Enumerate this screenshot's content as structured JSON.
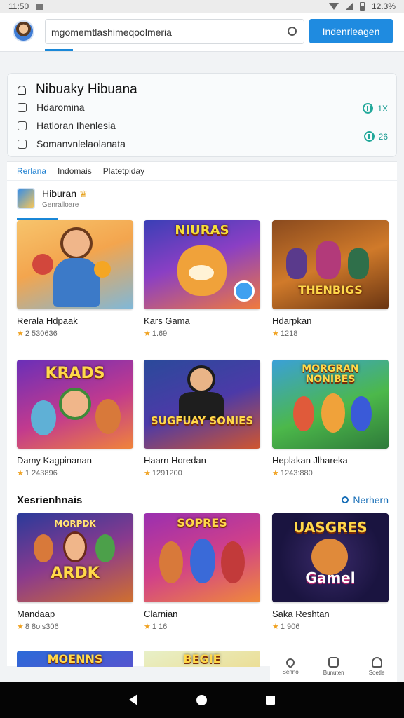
{
  "status_bar": {
    "time": "11:50",
    "battery": "12.3%"
  },
  "top_bar": {
    "search_value": "mgomemtlashimeqoolmeria",
    "button_label": "Indenrleagen"
  },
  "info_card": {
    "title": "Nibuaky Hibuana",
    "lines": [
      "Hdaromina",
      "Hatloran Ihenlesia",
      "Somanvnlelaolanata"
    ],
    "stats": [
      "1X",
      "26"
    ]
  },
  "tabs": [
    "Rerlana",
    "Indomais",
    "Platetpiday"
  ],
  "section": {
    "title": "Hiburan",
    "subtitle": "Genralloare"
  },
  "games_top": [
    {
      "name": "Rerala Hdpaak",
      "meta": "2 530636",
      "art": ""
    },
    {
      "name": "Kars Gama",
      "meta": "1.69",
      "art": "NIURAS"
    },
    {
      "name": "Hdarpkan",
      "meta": "1218",
      "art": "THENBIGS"
    },
    {
      "name": "Damy Kagpinanan",
      "meta": "1 243896",
      "art": "KRADS"
    },
    {
      "name": "Haarn Horedan",
      "meta": "1291200",
      "art": "SUGFUAY SONIES"
    },
    {
      "name": "Heplakan Jlhareka",
      "meta": "1243:880",
      "art": "MORGRAN NONIBES"
    }
  ],
  "more_section": {
    "title": "Xesrienhnais",
    "link": "Nerhern"
  },
  "games_more": [
    {
      "name": "Mandaap",
      "meta": "8 8ois306",
      "art": "ARDK",
      "art_sub": "MORPDK"
    },
    {
      "name": "Clarnian",
      "meta": "1 16",
      "art": "SOPRES"
    },
    {
      "name": "Saka Reshtan",
      "meta": "1 906",
      "art": "UASGRES",
      "art_sub": "Gamel"
    }
  ],
  "games_partial": [
    {
      "art": "MOENNS"
    },
    {
      "art": "BEGIE"
    }
  ],
  "bottom_dock": [
    {
      "label": "Senno",
      "icon": "heart-icon"
    },
    {
      "label": "Bunuten",
      "icon": "store-icon"
    },
    {
      "label": "Soetle",
      "icon": "profile-icon"
    }
  ]
}
